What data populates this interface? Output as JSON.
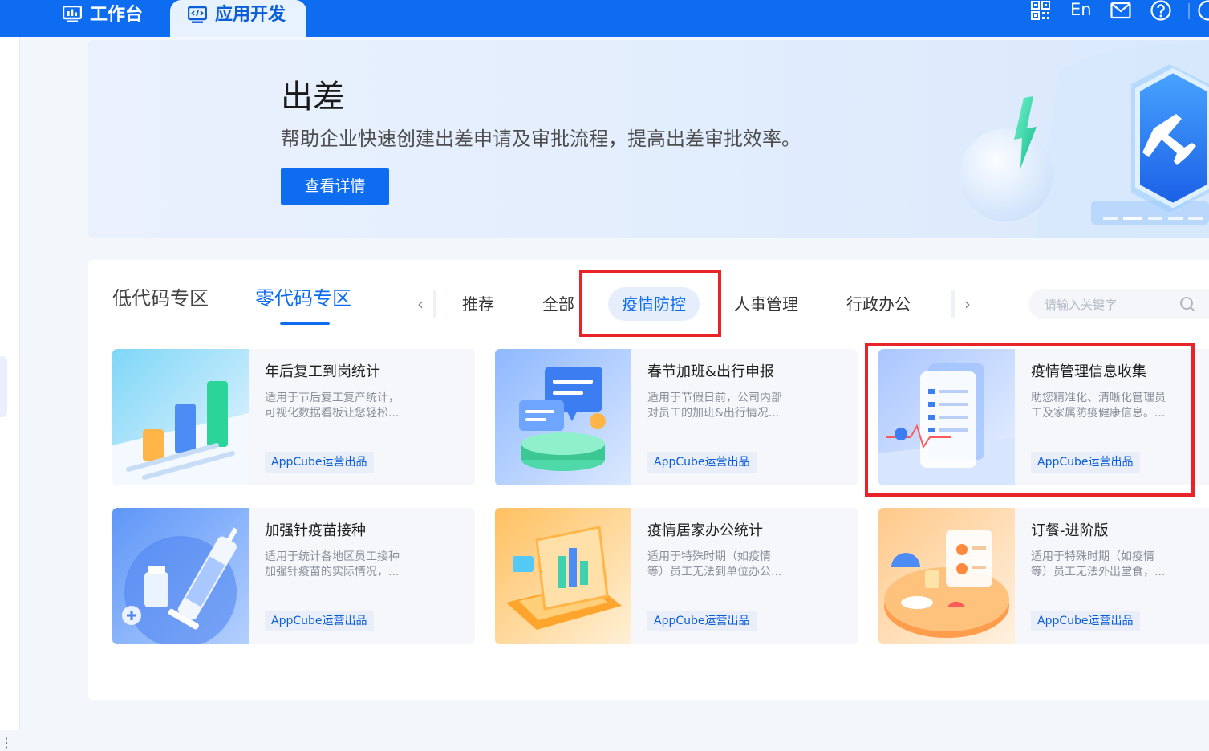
{
  "topbar": {
    "workbench_tab": "工作台",
    "appdev_tab": "应用开发",
    "lang_toggle": "En",
    "icons": [
      "qr-code-icon",
      "mail-icon",
      "help-icon",
      "avatar"
    ]
  },
  "banner": {
    "title": "出差",
    "description": "帮助企业快速创建出差申请及审批流程，提高出差审批效率。",
    "button_label": "查看详情"
  },
  "zones": {
    "low_code": "低代码专区",
    "zero_code": "零代码专区",
    "active": "零代码专区"
  },
  "categories": {
    "prev_arrow": "‹",
    "next_arrow": "›",
    "items": [
      "推荐",
      "全部",
      "疫情防控",
      "人事管理",
      "行政办公"
    ],
    "active": "疫情防控"
  },
  "search": {
    "placeholder": "请输入关键字",
    "value": ""
  },
  "cards": [
    {
      "title": "年后复工到岗统计",
      "desc_line1": "适用于节后复工复产统计，",
      "desc_line2": "可视化数据看板让您轻松...",
      "badge": "AppCube运营出品"
    },
    {
      "title": "春节加班&出行申报",
      "desc_line1": "适用于节假日前，公司内部",
      "desc_line2": "对员工的加班&出行情况...",
      "badge": "AppCube运营出品"
    },
    {
      "title": "疫情管理信息收集",
      "desc_line1": "助您精准化、清晰化管理员",
      "desc_line2": "工及家属防疫健康信息。...",
      "badge": "AppCube运营出品"
    },
    {
      "title": "加强针疫苗接种",
      "desc_line1": "适用于统计各地区员工接种",
      "desc_line2": "加强针疫苗的实际情况，...",
      "badge": "AppCube运营出品"
    },
    {
      "title": "疫情居家办公统计",
      "desc_line1": "适用于特殊时期（如疫情",
      "desc_line2": "等）员工无法到单位办公...",
      "badge": "AppCube运营出品"
    },
    {
      "title": "订餐-进阶版",
      "desc_line1": "适用于特殊时期（如疫情",
      "desc_line2": "等）员工无法外出堂食，...",
      "badge": "AppCube运营出品"
    }
  ],
  "colors": {
    "primary": "#0d6cf0",
    "highlight_border": "#e8242a",
    "badge_text": "#0a5ed7"
  }
}
